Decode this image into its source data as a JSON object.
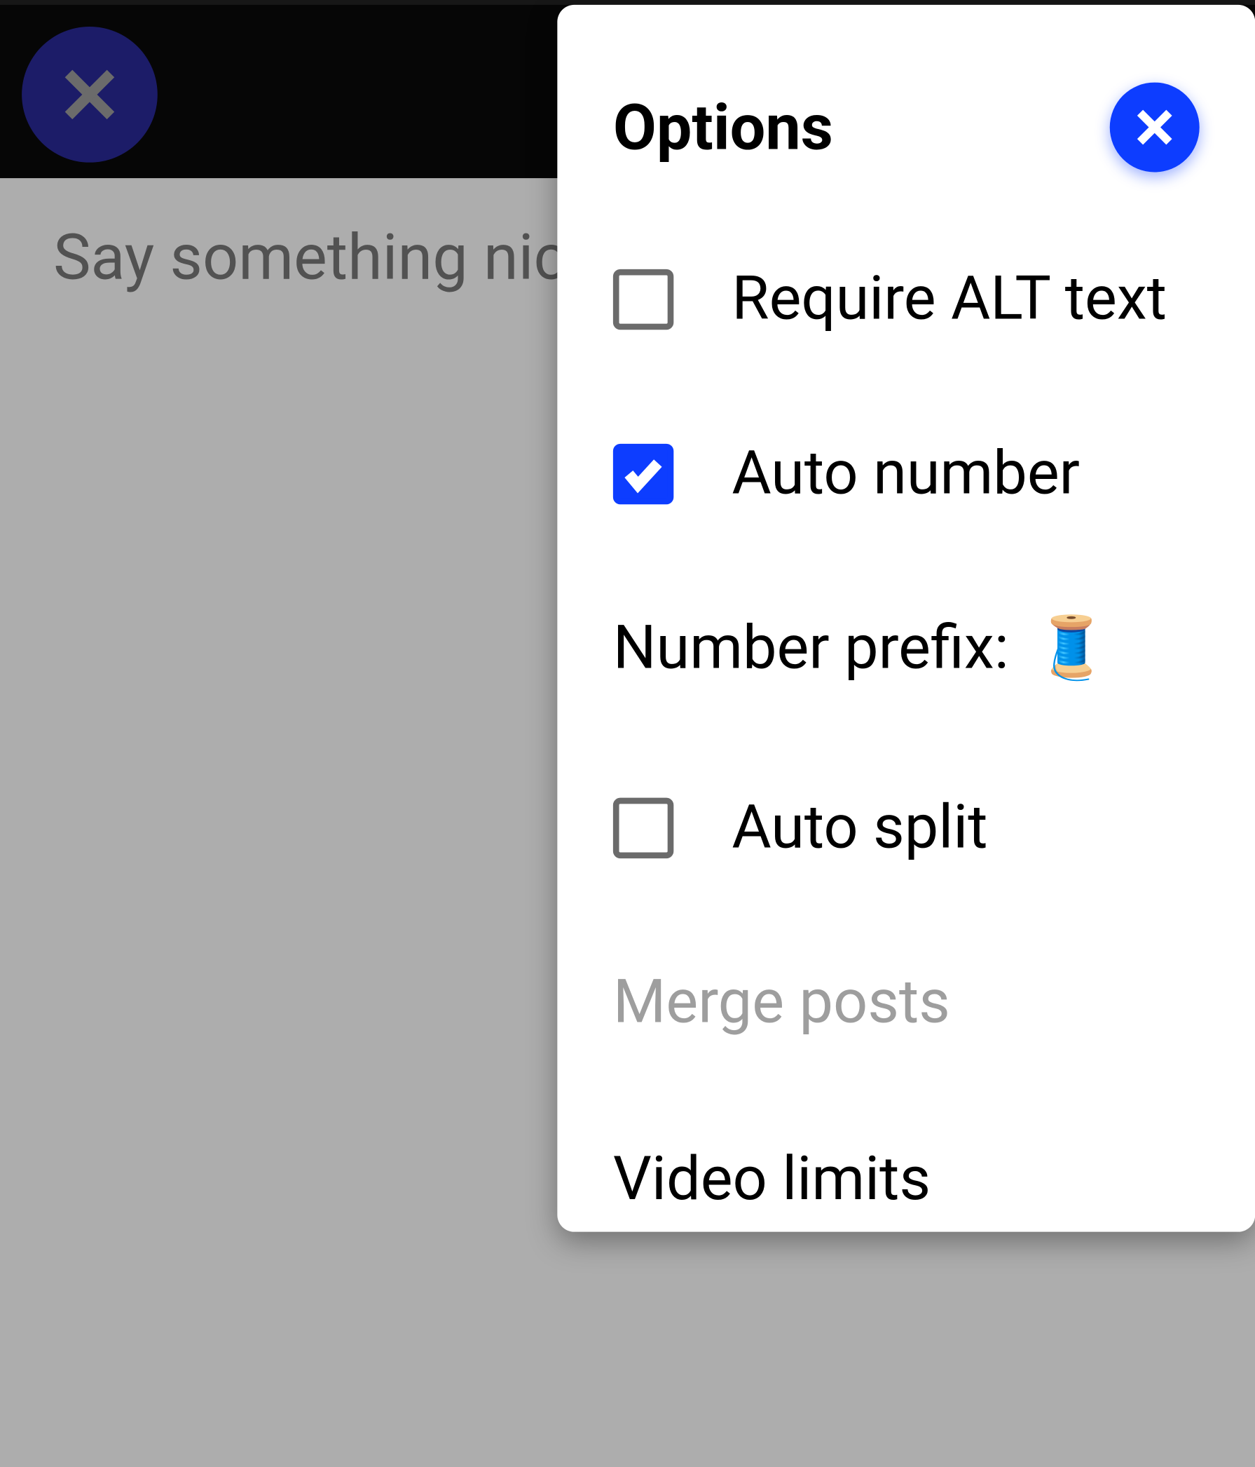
{
  "compose": {
    "placeholder": "Say something nic"
  },
  "panel": {
    "title": "Options",
    "options": {
      "require_alt": {
        "label": "Require ALT text",
        "checked": false
      },
      "auto_number": {
        "label": "Auto number",
        "checked": true
      },
      "prefix_label": "Number prefix:",
      "prefix_value": "🧵",
      "auto_split": {
        "label": "Auto split",
        "checked": false
      },
      "merge_posts": {
        "label": "Merge posts",
        "enabled": false
      },
      "video_limits": {
        "label": "Video limits",
        "enabled": true
      }
    }
  },
  "colors": {
    "accent": "#0d3dff",
    "main_close_bg": "#2a2a9a"
  }
}
